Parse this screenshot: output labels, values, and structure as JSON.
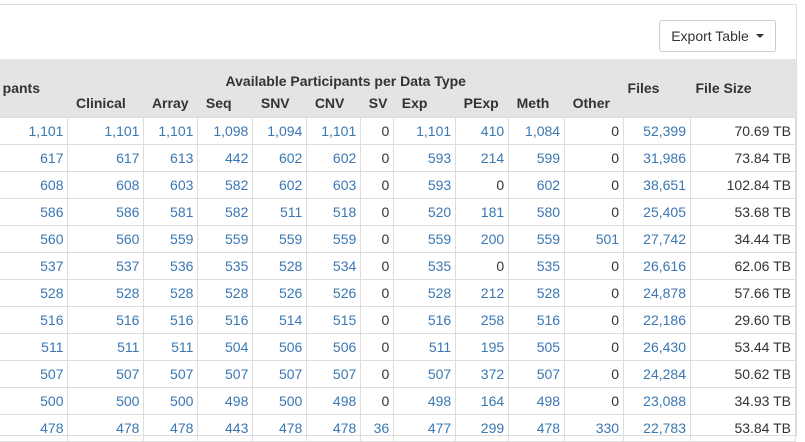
{
  "toolbar": {
    "export_label": "Export Table"
  },
  "table": {
    "group_header": "Available Participants per Data Type",
    "participants_header": "pants",
    "files_header": "Files",
    "size_header": "File Size",
    "sub_headers": [
      "Clinical",
      "Array",
      "Seq",
      "SNV",
      "CNV",
      "SV",
      "Exp",
      "PExp",
      "Meth",
      "Other"
    ],
    "rows": [
      [
        "1,101",
        "1,101",
        "1,101",
        "1,098",
        "1,094",
        "1,101",
        "0",
        "1,101",
        "410",
        "1,084",
        "0",
        "52,399",
        "70.69 TB"
      ],
      [
        "617",
        "617",
        "613",
        "442",
        "602",
        "602",
        "0",
        "593",
        "214",
        "599",
        "0",
        "31,986",
        "73.84 TB"
      ],
      [
        "608",
        "608",
        "603",
        "582",
        "602",
        "603",
        "0",
        "593",
        "0",
        "602",
        "0",
        "38,651",
        "102.84 TB"
      ],
      [
        "586",
        "586",
        "581",
        "582",
        "511",
        "518",
        "0",
        "520",
        "181",
        "580",
        "0",
        "25,405",
        "53.68 TB"
      ],
      [
        "560",
        "560",
        "559",
        "559",
        "559",
        "559",
        "0",
        "559",
        "200",
        "559",
        "501",
        "27,742",
        "34.44 TB"
      ],
      [
        "537",
        "537",
        "536",
        "535",
        "528",
        "534",
        "0",
        "535",
        "0",
        "535",
        "0",
        "26,616",
        "62.06 TB"
      ],
      [
        "528",
        "528",
        "528",
        "528",
        "526",
        "526",
        "0",
        "528",
        "212",
        "528",
        "0",
        "24,878",
        "57.66 TB"
      ],
      [
        "516",
        "516",
        "516",
        "516",
        "514",
        "515",
        "0",
        "516",
        "258",
        "516",
        "0",
        "22,186",
        "29.60 TB"
      ],
      [
        "511",
        "511",
        "511",
        "504",
        "506",
        "506",
        "0",
        "511",
        "195",
        "505",
        "0",
        "26,430",
        "53.44 TB"
      ],
      [
        "507",
        "507",
        "507",
        "507",
        "507",
        "507",
        "0",
        "507",
        "372",
        "507",
        "0",
        "24,284",
        "50.62 TB"
      ],
      [
        "500",
        "500",
        "500",
        "498",
        "500",
        "498",
        "0",
        "498",
        "164",
        "498",
        "0",
        "23,088",
        "34.93 TB"
      ],
      [
        "478",
        "478",
        "478",
        "443",
        "478",
        "478",
        "36",
        "477",
        "299",
        "478",
        "330",
        "22,783",
        "53.84 TB"
      ]
    ]
  }
}
